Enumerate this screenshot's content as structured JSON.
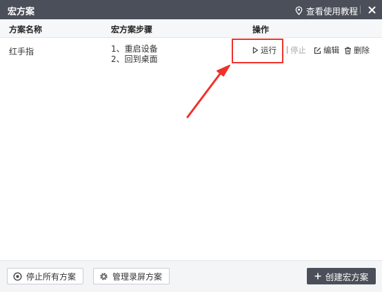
{
  "window": {
    "title": "宏方案",
    "tutorial_label": "查看使用教程"
  },
  "table": {
    "headers": [
      "方案名称",
      "宏方案步骤",
      "操作"
    ],
    "rows": [
      {
        "name": "红手指",
        "steps": [
          "1、重启设备",
          "2、回到桌面"
        ],
        "actions": {
          "run": "运行",
          "stop": "停止",
          "edit": "编辑",
          "delete": "删除"
        }
      }
    ]
  },
  "footer": {
    "stop_all": "停止所有方案",
    "manage": "管理录屏方案",
    "create": "创建宏方案"
  },
  "colors": {
    "titlebar": "#4a4f59",
    "annotation": "#f0312a",
    "disabled_text": "#aaaaaa"
  }
}
